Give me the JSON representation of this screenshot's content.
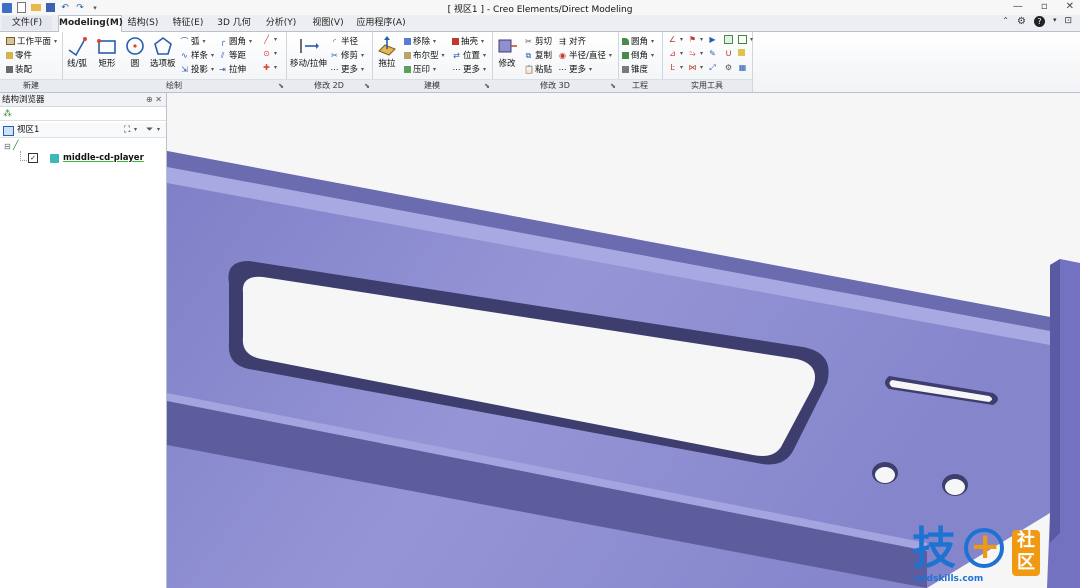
{
  "window": {
    "title": "[ 视区1 ] - Creo Elements/Direct Modeling"
  },
  "menu_tabs": [
    {
      "label": "文件(F)",
      "active": false
    },
    {
      "label": "Modeling(M)",
      "active": true
    },
    {
      "label": "结构(S)",
      "active": false
    },
    {
      "label": "特征(E)",
      "active": false
    },
    {
      "label": "3D 几何",
      "active": false
    },
    {
      "label": "分析(Y)",
      "active": false
    },
    {
      "label": "视图(V)",
      "active": false
    },
    {
      "label": "应用程序(A)",
      "active": false
    }
  ],
  "ribbon": {
    "new": {
      "label": "新建",
      "items": [
        "工作平面",
        "零件",
        "装配"
      ]
    },
    "draw": {
      "label": "绘制",
      "big": [
        "线/弧",
        "矩形",
        "圆",
        "选项板"
      ],
      "small": [
        "弧",
        "样条",
        "投影",
        "圆角",
        "等距",
        "拉伸"
      ]
    },
    "modify2d": {
      "label": "修改 2D",
      "big": [
        "移动/拉伸"
      ],
      "small": [
        "半径",
        "修剪",
        "更多"
      ]
    },
    "build": {
      "label": "建模",
      "big": [
        "拖拉"
      ],
      "small": [
        "移除",
        "布尔型",
        "压印",
        "抽壳",
        "位置",
        "更多"
      ]
    },
    "modify3d": {
      "label": "修改 3D",
      "big": [
        "修改"
      ],
      "small": [
        "剪切",
        "复制",
        "粘贴",
        "对齐",
        "半径/直径",
        "更多"
      ]
    },
    "engineering": {
      "label": "工程",
      "items": [
        "圆角",
        "倒角",
        "锥度"
      ]
    },
    "tools": {
      "label": "实用工具"
    }
  },
  "browser": {
    "title": "结构浏览器",
    "viewport_label": "视区1",
    "tree": [
      {
        "label": "middle-cd-player",
        "checked": true
      }
    ]
  },
  "model": {
    "face_color": "#8f8fd2",
    "edge_color": "#3d3d6e",
    "side_color": "#5d5d9e",
    "light_color": "#a4a4e0"
  },
  "watermark": {
    "char1": "技",
    "plus": "+",
    "badge_top": "社",
    "badge_bottom": "区",
    "url": "addskills.com",
    "blue": "#1e73d2",
    "orange": "#f09a14"
  },
  "colors": {
    "accent": "#2a6fc9",
    "tab_border": "#b9c2cc"
  }
}
